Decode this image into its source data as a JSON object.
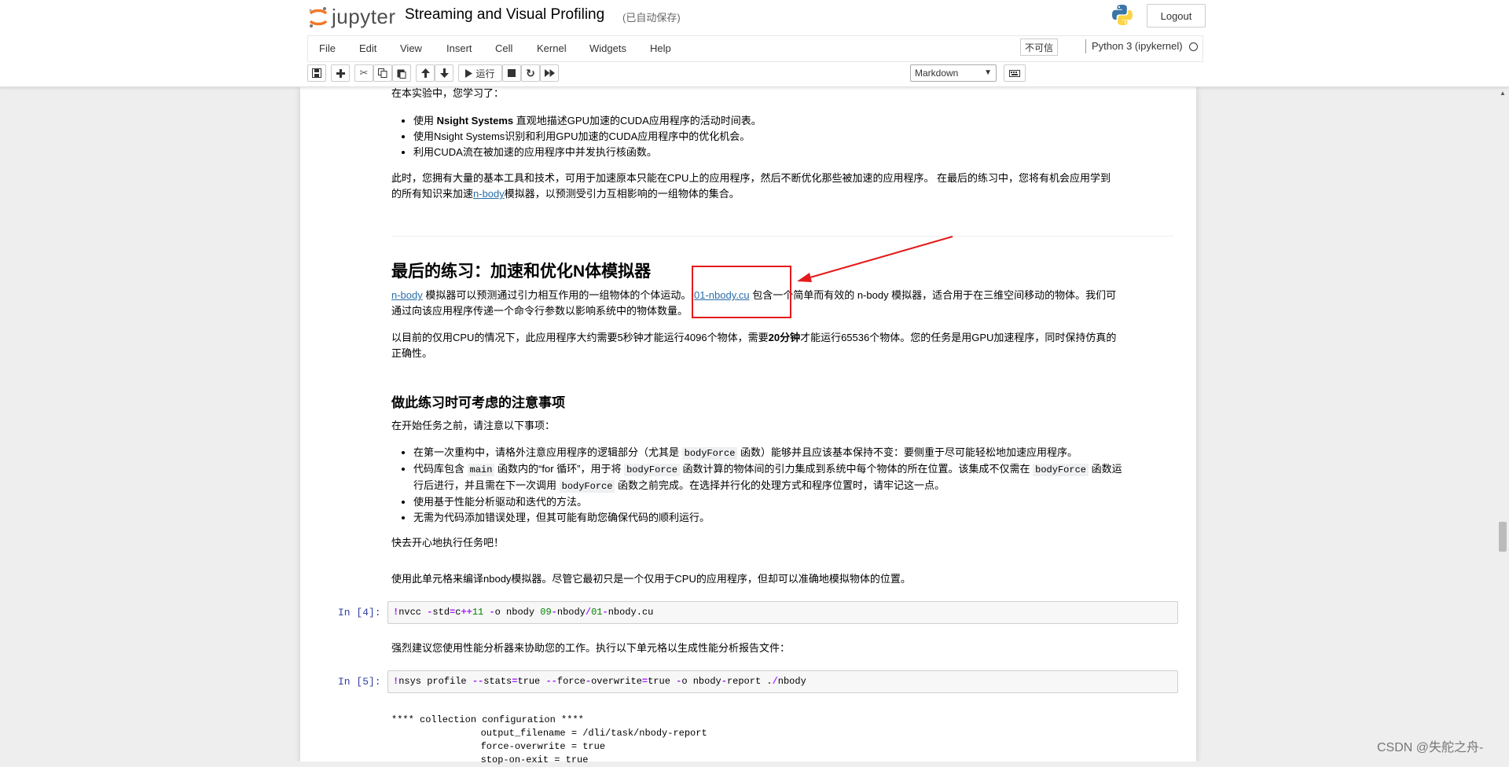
{
  "header": {
    "logo_text": "jupyter",
    "notebook_title": "Streaming and Visual Profiling",
    "autosave_status": "(已自动保存)",
    "logout_label": "Logout"
  },
  "menu": {
    "items": [
      "File",
      "Edit",
      "View",
      "Insert",
      "Cell",
      "Kernel",
      "Widgets",
      "Help"
    ],
    "trusted": "不可信",
    "kernel_name": "Python 3 (ipykernel)"
  },
  "toolbar": {
    "run_label": "运行",
    "cell_type": "Markdown"
  },
  "content": {
    "intro": "在本实验中，您学习了：",
    "learned": [
      [
        "使用 ",
        "Nsight Systems",
        " 直观地描述GPU加速的CUDA应用程序的活动时间表。"
      ],
      "使用Nsight Systems识别和利用GPU加速的CUDA应用程序中的优化机会。",
      "利用CUDA流在被加速的应用程序中并发执行核函数。"
    ],
    "para1_a": "此时，您拥有大量的基本工具和技术，可用于加速原本只能在CPU上的应用程序，然后不断优化那些被加速的应用程序。 在最后的练习中，您将有机会应用学到",
    "para1_b_pre": "的所有知识来加速",
    "para1_link": "n-body",
    "para1_b_post": "模拟器，以预测受引力互相影响的一组物体的集合。",
    "final_heading": "最后的练习：加速和优化N体模拟器",
    "nbody_link": "n-body",
    "nbody_text1": " 模拟器可以预测通过引力相互作用的一组物体的个体运动。",
    "file_link": "01-nbody.cu",
    "nbody_text2": " 包含一个简单而有效的 n-body 模拟器，适合用于在三维空间移动的物体。我们可",
    "nbody_text3": "通过向该应用程序传递一个命令行参数以影响系统中的物体数量。",
    "cpu_text_a": "以目前的仅用CPU的情况下，此应用程序大约需要5秒钟才能运行4096个物体，需要",
    "cpu_bold": "20分钟",
    "cpu_text_b": "才能运行65536个物体。您的任务是用GPU加速程序，同时保持仿真的",
    "cpu_text_c": "正确性。",
    "considerations_heading": "做此练习时可考虑的注意事项",
    "before_start": "在开始任务之前，请注意以下事项：",
    "consid_1a": "在第一次重构中，请格外注意应用程序的逻辑部分（尤其是 ",
    "consid_1code": "bodyForce",
    "consid_1b": " 函数）能够并且应该基本保持不变：要侧重于尽可能轻松地加速应用程序。",
    "consid_2a": "代码库包含 ",
    "consid_2code1": "main",
    "consid_2b": " 函数内的“for 循环”，用于将 ",
    "consid_2code2": "bodyForce",
    "consid_2c": " 函数计算的物体间的引力集成到系统中每个物体的所在位置。该集成不仅需在 ",
    "consid_2code3": "bodyForce",
    "consid_2d": " 函数运",
    "consid_2e": "行后进行，并且需在下一次调用 ",
    "consid_2code4": "bodyForce",
    "consid_2f": " 函数之前完成。在选择并行化的处理方式和程序位置时，请牢记这一点。",
    "consid_3": "使用基于性能分析驱动和迭代的方法。",
    "consid_4": "无需为代码添加错误处理，但其可能有助您确保代码的顺利运行。",
    "enjoy": "快去开心地执行任务吧！",
    "compile_desc": "使用此单元格来编译nbody模拟器。尽管它最初只是一个仅用于CPU的应用程序，但却可以准确地模拟物体的位置。",
    "cell4_prompt": "In  [4]:",
    "cell4_code": "!nvcc -std=c++11 -o nbody 09-nbody/01-nbody.cu",
    "profile_desc": "强烈建议您使用性能分析器来协助您的工作。执行以下单元格以生成性能分析报告文件：",
    "cell5_prompt": "In  [5]:",
    "cell5_code": "!nsys profile --stats=true --force-overwrite=true -o nbody-report ./nbody",
    "output_lines": [
      "**** collection configuration ****",
      "\toutput_filename = /dli/task/nbody-report",
      "\tforce-overwrite = true",
      "\tstop-on-exit = true"
    ]
  },
  "watermark": "CSDN @失舵之舟-"
}
